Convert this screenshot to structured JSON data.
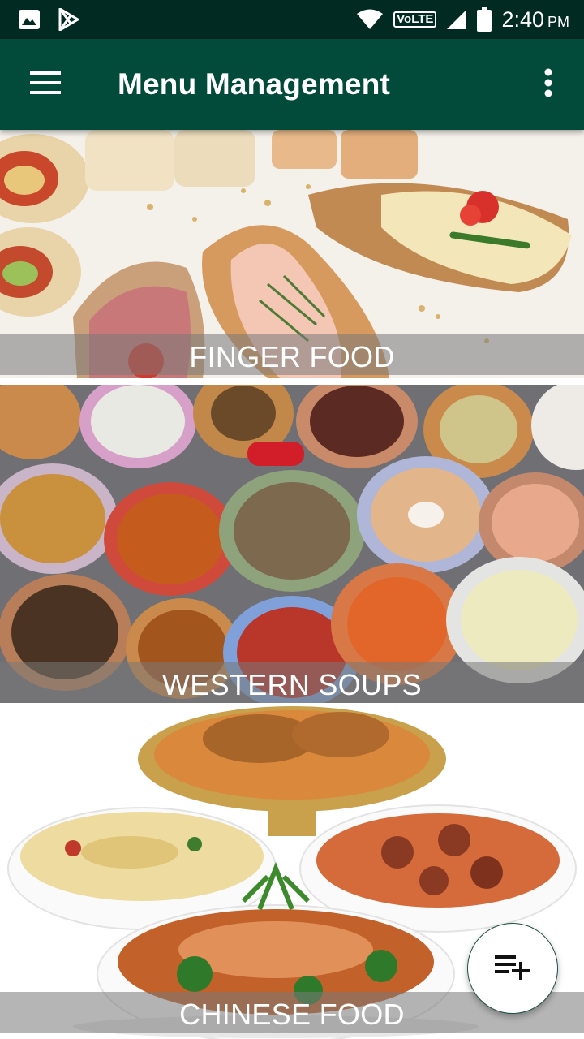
{
  "status_bar": {
    "time": "2:40",
    "ampm": "PM",
    "network_label": "VoLTE",
    "icons": [
      "image-icon",
      "play-store-icon",
      "wifi-icon",
      "volte-icon",
      "signal-icon",
      "battery-icon"
    ]
  },
  "app_bar": {
    "title": "Menu Management",
    "menu_icon": "hamburger-menu-icon",
    "overflow_icon": "more-vert-icon",
    "background": "#024a3a"
  },
  "categories": [
    {
      "label": "FINGER FOOD"
    },
    {
      "label": "WESTERN SOUPS"
    },
    {
      "label": "CHINESE FOOD"
    }
  ],
  "fab": {
    "icon": "playlist-add-icon"
  }
}
